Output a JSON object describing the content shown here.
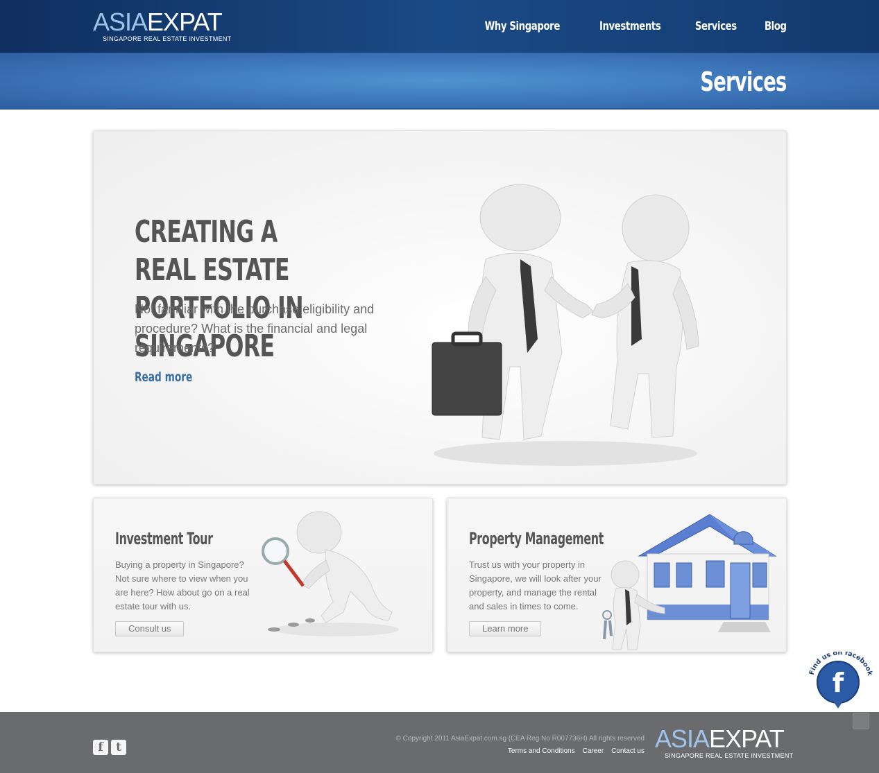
{
  "header": {
    "logo_main_a": "ASIA",
    "logo_main_b": "EXPAT",
    "logo_sub": "SINGAPORE REAL ESTATE INVESTMENT",
    "nav": [
      {
        "label": "Why Singapore"
      },
      {
        "label": "Investments"
      },
      {
        "label": "Services"
      },
      {
        "label": "Blog"
      }
    ]
  },
  "banner": {
    "title": "Services"
  },
  "hero": {
    "title": "CREATING A REAL ESTATE PORTFOLIO IN SINGAPORE",
    "text": "Not familiar with the purchase eligibility and procedure? What is the financial and legal requirements?",
    "link": "Read more"
  },
  "cards": [
    {
      "title": "Investment Tour",
      "text": "Buying a property in Singapore? Not sure where to view when you are here? How about go on a real estate tour with us.",
      "button": "Consult us"
    },
    {
      "title": "Property Management",
      "text": "Trust us with your property in Singapore, we will look after your property, and manage the rental and sales in times to come.",
      "button": "Learn more"
    }
  ],
  "facebook": {
    "label": "Find us on facebook"
  },
  "footer": {
    "copyright": "© Copyright 2011 AsiaExpat.com.sg (CEA Reg No R007736H) All rights reserved",
    "links": [
      {
        "label": "Terms and Conditions"
      },
      {
        "label": "Career"
      },
      {
        "label": "Contact us"
      }
    ],
    "logo_main_a": "ASIA",
    "logo_main_b": "EXPAT",
    "logo_sub": "SINGAPORE REAL ESTATE INVESTMENT",
    "social": [
      {
        "icon": "facebook-icon",
        "glyph": "f"
      },
      {
        "icon": "twitter-icon",
        "glyph": "t"
      }
    ]
  },
  "colors": {
    "header": "#1a4a85",
    "banner": "#4f93d0",
    "link": "#3a6ea8",
    "footer": "#6a6b6d"
  }
}
